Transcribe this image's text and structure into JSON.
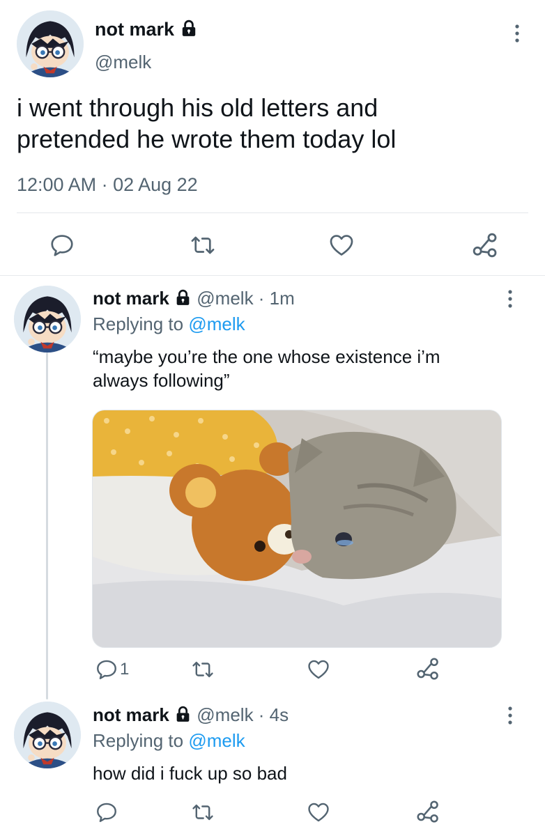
{
  "main_tweet": {
    "display_name": "not mark",
    "handle": "@melk",
    "text_line1": "i went through his old letters and",
    "text_line2": "pretended he wrote them today lol",
    "timestamp": "12:00 AM · 02 Aug 22"
  },
  "reply1": {
    "display_name": "not mark",
    "handle_time": "@melk · 1m",
    "replying_prefix": "Replying to",
    "replying_handle": "@melk",
    "text_line1": "“maybe you’re the one whose existence i’m",
    "text_line2": "always following”",
    "reply_count": "1"
  },
  "reply2": {
    "display_name": "not mark",
    "handle_time": "@melk · 4s",
    "replying_prefix": "Replying to",
    "replying_handle": "@melk",
    "text": "how did i fuck up so bad"
  },
  "icons": {
    "reply": "speech-bubble-icon",
    "retweet": "retweet-arrows-icon",
    "like": "heart-outline-icon",
    "share": "share-nodes-icon",
    "more": "vertical-dots-icon",
    "lock": "lock-icon"
  },
  "colors": {
    "text": "#0f1419",
    "muted": "#536471",
    "link": "#1d9bf0",
    "divider": "#e4e7ea"
  }
}
